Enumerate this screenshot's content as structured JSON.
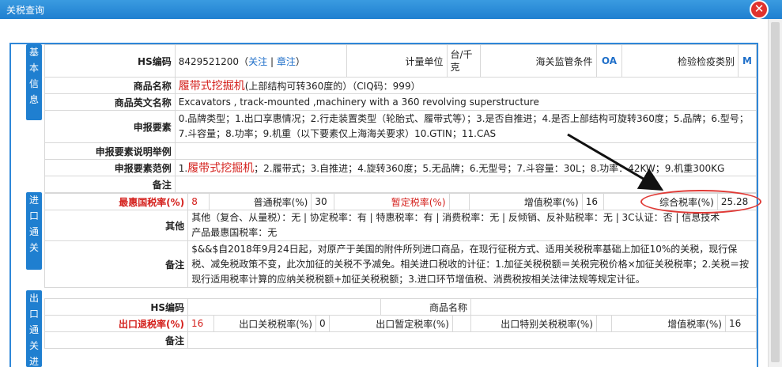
{
  "window": {
    "title": "关税查询",
    "close_glyph": "✕"
  },
  "sections": {
    "basic": [
      "基",
      "本",
      "信",
      "息"
    ],
    "import": [
      "进",
      "口",
      "通",
      "关"
    ],
    "export": [
      "出",
      "口",
      "通",
      "关",
      "进"
    ]
  },
  "basic": {
    "hs_label": "HS编码",
    "hs_value": "8429521200",
    "follow": "关注",
    "sep": "|",
    "chapter": "章注",
    "unit_label": "计量单位",
    "unit_value": "台/千克",
    "customs_label": "海关监管条件",
    "customs_value": "OA",
    "inspect_label": "检验检疫类别",
    "inspect_value": "M",
    "name_label": "商品名称",
    "name_main": "履带式挖掘机",
    "name_rest": "(上部结构可转360度的）（CIQ码：999）",
    "en_label": "商品英文名称",
    "en_value": "Excavators , track-mounted ,machinery with a 360 revolving superstructure",
    "decl_label": "申报要素",
    "decl_value": "0.品牌类型；1.出口享惠情况；2.行走装置类型（轮胎式、履带式等）；3.是否自推进；4.是否上部结构可旋转360度；5.品牌；6.型号；7.斗容量；8.功率；9.机重（以下要素仅上海海关要求）10.GTIN；11.CAS",
    "desc_label": "申报要素说明举例",
    "example_label": "申报要素范例",
    "example_pre": "1.",
    "example_red": "履带式挖掘机",
    "example_rest": "；2.履带式；3.自推进；4.旋转360度；5.无品牌；6.无型号；7.斗容量：30L；8.功率：42KW；9.机重300KG",
    "remark_label": "备注"
  },
  "import": {
    "mfn_label": "最惠国税率(%)",
    "mfn_value": "8",
    "general_label": "普通税率(%)",
    "general_value": "30",
    "temp_label": "暂定税率(%)",
    "temp_value": "",
    "vat_label": "增值税率(%)",
    "vat_value": "16",
    "comp_label": "综合税率(%)",
    "comp_value": "25.28",
    "other_label": "其他",
    "other_line1": "其他（复合、从量税）：无 | 协定税率：有 | 特惠税率：有 | 消费税率：无 | 反倾销、反补贴税率：无 | 3C认证：否 | 信息技术",
    "other_line2": "产品最惠国税率：无",
    "remark_label": "备注",
    "remark_value": "$&&$自2018年9月24日起，对原产于美国的附件所列进口商品，在现行征税方式、适用关税税率基础上加征10%的关税，现行保税、减免税政策不变，此次加征的关税不予减免。相关进口税收的计征：1.加征关税税额＝关税完税价格×加征关税税率；2.关税＝按现行适用税率计算的应纳关税税额+加征关税税额；3.进口环节增值税、消费税按相关法律法规等规定计征。"
  },
  "export": {
    "hs_label": "HS编码",
    "hs_value": "",
    "name_label": "商品名称",
    "name_value": "",
    "rebate_label": "出口退税率(%)",
    "rebate_value": "16",
    "duty_label": "出口关税税率(%)",
    "duty_value": "0",
    "temp_label": "出口暂定税率(%)",
    "temp_value": "",
    "special_label": "出口特别关税税率(%)",
    "special_value": "",
    "vat_label": "增值税率(%)",
    "vat_value": "16",
    "remark_label": "备注"
  },
  "colors": {
    "accent": "#1f7fd0",
    "highlight": "#d4201c",
    "annotation": "#e03a36"
  }
}
